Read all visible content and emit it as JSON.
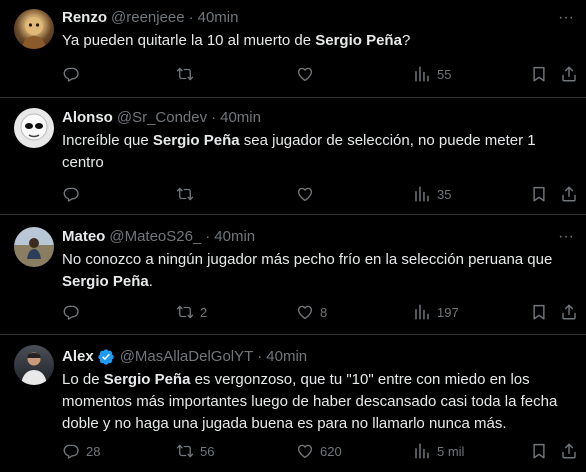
{
  "tweets": [
    {
      "name": "Renzo",
      "handle": "@reenjeee",
      "time": "40min",
      "verified": false,
      "text_parts": [
        "Ya pueden quitarle la 10 al muerto de ",
        "Sergio Peña",
        "?"
      ],
      "replies": "",
      "retweets": "",
      "likes": "",
      "views": "55"
    },
    {
      "name": "Alonso",
      "handle": "@Sr_Condev",
      "time": "40min",
      "verified": false,
      "text_parts": [
        "Increíble que ",
        "Sergio Peña",
        " sea jugador de selección, no puede meter 1 centro"
      ],
      "replies": "",
      "retweets": "",
      "likes": "",
      "views": "35"
    },
    {
      "name": "Mateo",
      "handle": "@MateoS26_",
      "time": "40min",
      "verified": false,
      "text_parts": [
        "No conozco a ningún jugador más pecho frío en la selección peruana que ",
        "Sergio Peña",
        "."
      ],
      "replies": "",
      "retweets": "2",
      "likes": "8",
      "views": "197"
    },
    {
      "name": "Alex",
      "handle": "@MasAllaDelGolYT",
      "time": "40min",
      "verified": true,
      "text_parts": [
        "Lo de ",
        "Sergio Peña",
        " es vergonzoso, que tu \"10\" entre con miedo en los momentos más importantes luego de haber descansado casi toda la fecha doble y no haga una jugada buena es para no llamarlo nunca más."
      ],
      "replies": "28",
      "retweets": "56",
      "likes": "620",
      "views": "5 mil"
    }
  ],
  "colors": {
    "text": "#e7e9ea",
    "muted": "#71767b",
    "verified": "#1d9bf0",
    "border": "#2f3336"
  },
  "icons": [
    "reply-icon",
    "retweet-icon",
    "like-icon",
    "views-icon",
    "bookmark-icon",
    "share-icon",
    "more-icon",
    "verified-badge-icon"
  ]
}
